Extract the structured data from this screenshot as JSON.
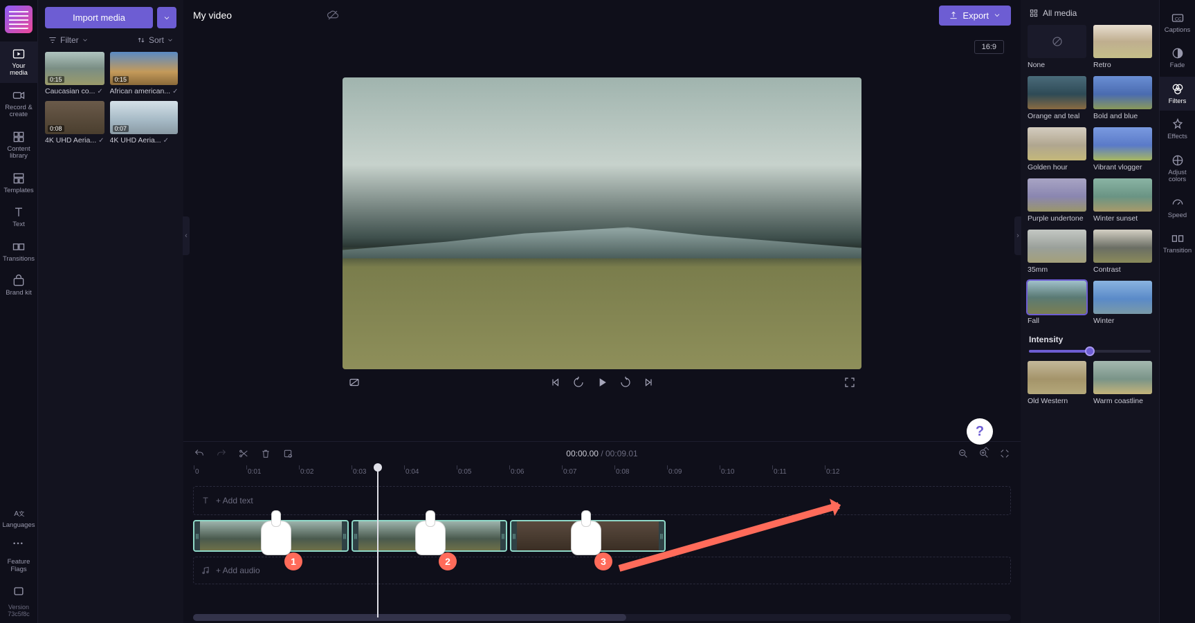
{
  "left_rail": {
    "your_media": "Your media",
    "record": "Record & create",
    "content": "Content library",
    "templates": "Templates",
    "text": "Text",
    "transitions": "Transitions",
    "brand": "Brand kit",
    "languages": "Languages",
    "feature": "Feature Flags",
    "version_label": "Version",
    "version_value": "73c5f8c"
  },
  "media_panel": {
    "import": "Import media",
    "filter": "Filter",
    "sort": "Sort",
    "items": [
      {
        "dur": "0:15",
        "name": "Caucasian co..."
      },
      {
        "dur": "0:15",
        "name": "African american..."
      },
      {
        "dur": "0:08",
        "name": "4K UHD Aeria..."
      },
      {
        "dur": "0:07",
        "name": "4K UHD Aeria..."
      }
    ]
  },
  "top_bar": {
    "title": "My video",
    "export": "Export"
  },
  "preview": {
    "aspect": "16:9"
  },
  "timeline": {
    "current": "00:00.00",
    "total": "00:09.01",
    "ticks": [
      "0",
      "0:01",
      "0:02",
      "0:03",
      "0:04",
      "0:05",
      "0:06",
      "0:07",
      "0:08",
      "0:09",
      "0:10",
      "0:11",
      "0:12"
    ],
    "add_text": "+ Add text",
    "add_audio": "+ Add audio"
  },
  "right_panel": {
    "header": "All media",
    "intensity": "Intensity",
    "intensity_value": 50,
    "filters": [
      {
        "name": "None",
        "cls": "ft-none"
      },
      {
        "name": "Retro",
        "cls": "ft-retro"
      },
      {
        "name": "Orange and teal",
        "cls": "ft-orange"
      },
      {
        "name": "Bold and blue",
        "cls": "ft-bold"
      },
      {
        "name": "Golden hour",
        "cls": "ft-golden"
      },
      {
        "name": "Vibrant vlogger",
        "cls": "ft-vibrant"
      },
      {
        "name": "Purple undertone",
        "cls": "ft-purple"
      },
      {
        "name": "Winter sunset",
        "cls": "ft-wsunset"
      },
      {
        "name": "35mm",
        "cls": "ft-35"
      },
      {
        "name": "Contrast",
        "cls": "ft-contrast"
      },
      {
        "name": "Fall",
        "cls": "ft-fall",
        "selected": true
      },
      {
        "name": "Winter",
        "cls": "ft-winter"
      },
      {
        "name": "Old Western",
        "cls": "ft-owest"
      },
      {
        "name": "Warm coastline",
        "cls": "ft-warm"
      }
    ]
  },
  "right_rail": {
    "captions": "Captions",
    "fade": "Fade",
    "filters": "Filters",
    "effects": "Effects",
    "adjust": "Adjust colors",
    "speed": "Speed",
    "transition": "Transition"
  },
  "annotations": {
    "p1": "1",
    "p2": "2",
    "p3": "3"
  }
}
